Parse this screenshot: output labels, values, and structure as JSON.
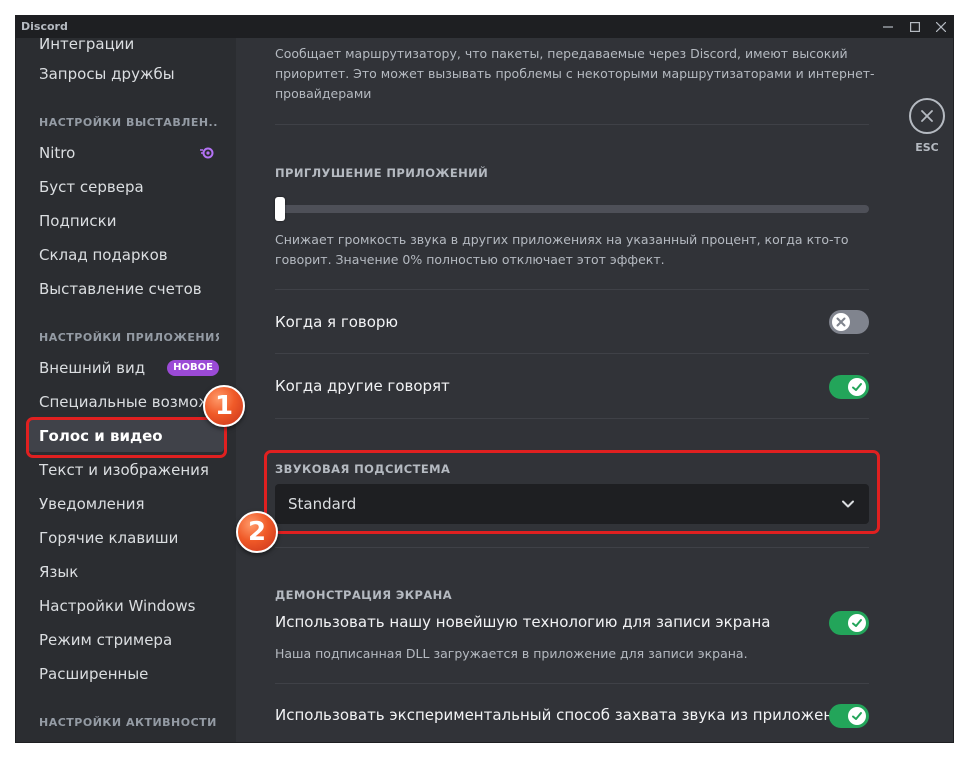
{
  "titlebar": {
    "title": "Discord"
  },
  "sidebar": {
    "items_top": [
      {
        "label": "Интеграции"
      },
      {
        "label": "Запросы дружбы"
      }
    ],
    "section_billing": "НАСТРОЙКИ ВЫСТАВЛЕН...",
    "items_billing": [
      {
        "label": "Nitro"
      },
      {
        "label": "Буст сервера"
      },
      {
        "label": "Подписки"
      },
      {
        "label": "Склад подарков"
      },
      {
        "label": "Выставление счетов"
      }
    ],
    "section_app": "НАСТРОЙКИ ПРИЛОЖЕНИЯ",
    "items_app": [
      {
        "label": "Внешний вид",
        "badge": "НОВОЕ"
      },
      {
        "label": "Специальные возмож..."
      },
      {
        "label": "Голос и видео"
      },
      {
        "label": "Текст и изображения"
      },
      {
        "label": "Уведомления"
      },
      {
        "label": "Горячие клавиши"
      },
      {
        "label": "Язык"
      },
      {
        "label": "Настройки Windows"
      },
      {
        "label": "Режим стримера"
      },
      {
        "label": "Расширенные"
      }
    ],
    "section_activity": "НАСТРОЙКИ АКТИВНОСТИ"
  },
  "content": {
    "qos_desc": "Сообщает маршрутизатору, что пакеты, передаваемые через Discord, имеют высокий приоритет. Это может вызывать проблемы с некоторыми маршрутизаторами и интернет-провайдерами",
    "attenuation": {
      "title": "ПРИГЛУШЕНИЕ ПРИЛОЖЕНИЙ",
      "value_percent": 0,
      "desc": "Снижает громкость звука в других приложениях на указанный процент, когда кто-то говорит. Значение 0% полностью отключает этот эффект.",
      "when_i_speak": {
        "label": "Когда я говорю",
        "enabled": false
      },
      "when_others_speak": {
        "label": "Когда другие говорят",
        "enabled": true
      }
    },
    "audio_subsystem": {
      "title": "ЗВУКОВАЯ ПОДСИСТЕМА",
      "value": "Standard"
    },
    "screen_share": {
      "title": "ДЕМОНСТРАЦИЯ ЭКРАНА",
      "latest_tech": {
        "label": "Использовать нашу новейшую технологию для записи экрана",
        "desc": "Наша подписанная DLL загружается в приложение для записи экрана.",
        "enabled": true
      },
      "experimental_audio": {
        "label": "Использовать экспериментальный способ захвата звука из приложений",
        "enabled": true
      }
    },
    "esc_label": "ESC"
  },
  "annotations": {
    "step1": "1",
    "step2": "2"
  },
  "colors": {
    "toggle_on": "#23a55a",
    "toggle_off": "#80848e",
    "badge_new": "#9b4ad6",
    "annotation_red": "#e02020",
    "annotation_circle": "#f05a28"
  }
}
